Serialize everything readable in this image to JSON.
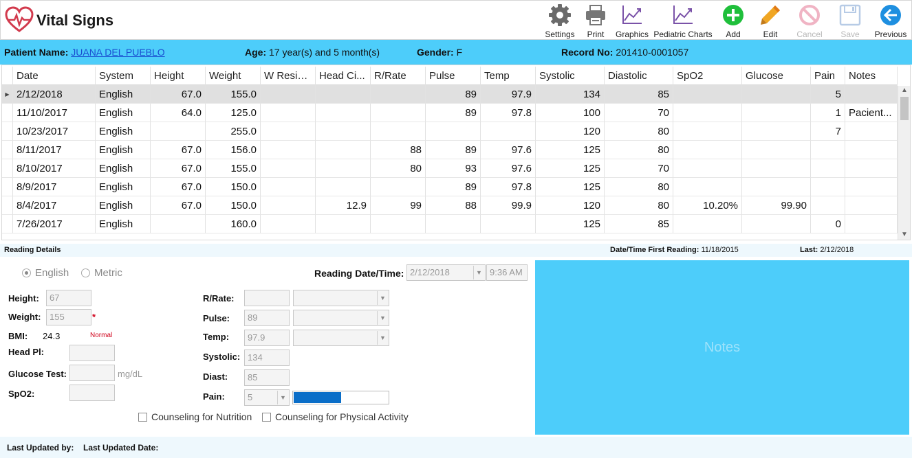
{
  "app": {
    "title": "Vital Signs"
  },
  "toolbar": [
    {
      "label": "Settings",
      "icon": "gear-icon",
      "disabled": false
    },
    {
      "label": "Print",
      "icon": "printer-icon",
      "disabled": false
    },
    {
      "label": "Graphics",
      "icon": "line-chart-icon",
      "disabled": false
    },
    {
      "label": "Pediatric Charts",
      "icon": "line-chart-icon",
      "disabled": false
    },
    {
      "label": "Add",
      "icon": "plus-circle-icon",
      "disabled": false
    },
    {
      "label": "Edit",
      "icon": "pencil-icon",
      "disabled": false
    },
    {
      "label": "Cancel",
      "icon": "cancel-icon",
      "disabled": true
    },
    {
      "label": "Save",
      "icon": "floppy-disk-icon",
      "disabled": true
    },
    {
      "label": "Previous",
      "icon": "back-arrow-icon",
      "disabled": false
    }
  ],
  "patient": {
    "name_label": "Patient Name:",
    "name": "JUANA DEL PUEBLO ",
    "age_label": "Age:",
    "age": "17 year(s) and 5 month(s)",
    "gender_label": "Gender:",
    "gender": "F",
    "record_label": "Record No:",
    "record": "201410-0001057"
  },
  "grid": {
    "columns": [
      "Date",
      "System",
      "Height",
      "Weight",
      "W Resid...",
      "Head Ci...",
      "R/Rate",
      "Pulse",
      "Temp",
      "Systolic",
      "Diastolic",
      "SpO2",
      "Glucose",
      "Pain",
      "Notes"
    ],
    "rows": [
      [
        "2/12/2018",
        "English",
        "67.0",
        "155.0",
        "",
        "",
        "",
        "89",
        "97.9",
        "134",
        "85",
        "",
        "",
        "5",
        ""
      ],
      [
        "11/10/2017",
        "English",
        "64.0",
        "125.0",
        "",
        "",
        "",
        "89",
        "97.8",
        "100",
        "70",
        "",
        "",
        "1",
        "Pacient..."
      ],
      [
        "10/23/2017",
        "English",
        "",
        "255.0",
        "",
        "",
        "",
        "",
        "",
        "120",
        "80",
        "",
        "",
        "7",
        ""
      ],
      [
        "8/11/2017",
        "English",
        "67.0",
        "156.0",
        "",
        "",
        "88",
        "89",
        "97.6",
        "125",
        "80",
        "",
        "",
        "",
        ""
      ],
      [
        "8/10/2017",
        "English",
        "67.0",
        "155.0",
        "",
        "",
        "80",
        "93",
        "97.6",
        "125",
        "70",
        "",
        "",
        "",
        ""
      ],
      [
        "8/9/2017",
        "English",
        "67.0",
        "150.0",
        "",
        "",
        "",
        "89",
        "97.8",
        "125",
        "80",
        "",
        "",
        "",
        ""
      ],
      [
        "8/4/2017",
        "English",
        "67.0",
        "150.0",
        "",
        "12.9",
        "99",
        "88",
        "99.9",
        "120",
        "80",
        "10.20%",
        "99.90",
        "",
        ""
      ],
      [
        "7/26/2017",
        "English",
        "",
        "160.0",
        "",
        "",
        "",
        "",
        "",
        "125",
        "85",
        "",
        "",
        "0",
        ""
      ]
    ],
    "selected_row": 0
  },
  "reading_details": {
    "title": "Reading Details",
    "first_label": "Date/Time First Reading:",
    "first_value": "11/18/2015",
    "last_label": "Last:",
    "last_value": "2/12/2018"
  },
  "form": {
    "unit_english": "English",
    "unit_metric": "Metric",
    "selected_unit": "English",
    "reading_datetime_label": "Reading Date/Time:",
    "reading_date": "2/12/2018",
    "reading_time": "9:36 AM",
    "height_label": "Height:",
    "height": "67",
    "weight_label": "Weight:",
    "weight": "155",
    "required_mark": "*",
    "bmi_label": "BMI:",
    "bmi": "24.3",
    "bmi_status": "Normal",
    "headpl_label": "Head Pl:",
    "headpl": "",
    "glucose_label": "Glucose Test:",
    "glucose": "",
    "glucose_unit": "mg/dL",
    "spo2_label": "SpO2:",
    "spo2": "",
    "rrate_label": "R/Rate:",
    "rrate": "",
    "pulse_label": "Pulse:",
    "pulse": "89",
    "temp_label": "Temp:",
    "temp": "97.9",
    "systolic_label": "Systolic:",
    "systolic": "134",
    "diast_label": "Diast:",
    "diast": "85",
    "pain_label": "Pain:",
    "pain": "5",
    "pain_level_fraction": 0.5,
    "pain_bar_color": "#0a6ec8",
    "counsel_nutrition": "Counseling for Nutrition",
    "counsel_activity": "Counseling for Physical Activity"
  },
  "notes": {
    "placeholder": "Notes"
  },
  "footer": {
    "updated_by_label": "Last Updated by:",
    "updated_date_label": "Last Updated Date:"
  },
  "colors": {
    "accent": "#4dcdfa",
    "subbar": "#eef8fd",
    "logo": "#d23a4d",
    "add": "#1fbf3b",
    "edit": "#f0a623",
    "previous": "#1e8fe0"
  }
}
